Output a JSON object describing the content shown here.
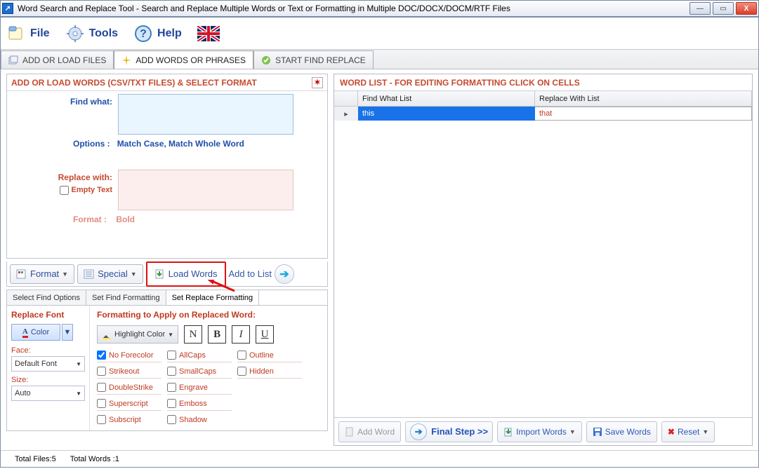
{
  "window": {
    "title": "Word Search and Replace Tool - Search and Replace Multiple Words or Text  or Formatting in Multiple DOC/DOCX/DOCM/RTF Files"
  },
  "menu": {
    "file": "File",
    "tools": "Tools",
    "help": "Help"
  },
  "tabs": {
    "add_files": "ADD OR LOAD FILES",
    "add_words": "ADD WORDS OR PHRASES",
    "start": "START FIND REPLACE"
  },
  "left_panel": {
    "title": "ADD OR LOAD WORDS (CSV/TXT FILES) & SELECT FORMAT",
    "find_what": "Find what:",
    "options_label": "Options :",
    "options_value": "Match Case, Match Whole Word",
    "replace_with": "Replace with:",
    "empty_text": "Empty Text",
    "format_label": "Format :",
    "format_value": "Bold"
  },
  "mid_buttons": {
    "format": "Format",
    "special": "Special",
    "load_words": "Load Words",
    "add_to_list": "Add to List"
  },
  "inner_tabs": {
    "select_find": "Select Find Options",
    "set_find": "Set Find Formatting",
    "set_replace": "Set Replace Formatting"
  },
  "replace_font": {
    "header": "Replace Font",
    "color": "Color",
    "face_label": "Face:",
    "face_value": "Default Font",
    "size_label": "Size:",
    "size_value": "Auto"
  },
  "formatting": {
    "header": "Formatting to Apply on Replaced Word:",
    "highlight": "Highlight Color",
    "n": "N",
    "b": "B",
    "i": "I",
    "u": "U",
    "items": {
      "no_forecolor": "No Forecolor",
      "strikeout": "Strikeout",
      "doublestrike": "DoubleStrike",
      "superscript": "Superscript",
      "subscript": "Subscript",
      "allcaps": "AllCaps",
      "smallcaps": "SmallCaps",
      "engrave": "Engrave",
      "emboss": "Emboss",
      "shadow": "Shadow",
      "outline": "Outline",
      "hidden": "Hidden"
    }
  },
  "wordlist": {
    "title": "WORD LIST - FOR EDITING FORMATTING CLICK ON CELLS",
    "col_find": "Find What List",
    "col_replace": "Replace With List",
    "row0_find": "this",
    "row0_replace": "that"
  },
  "right_toolbar": {
    "add_word": "Add Word",
    "final_step": "Final Step >>",
    "import_words": "Import Words",
    "save_words": "Save Words",
    "reset": "Reset"
  },
  "status": {
    "files": "Total Files:5",
    "words": "Total Words :1"
  }
}
